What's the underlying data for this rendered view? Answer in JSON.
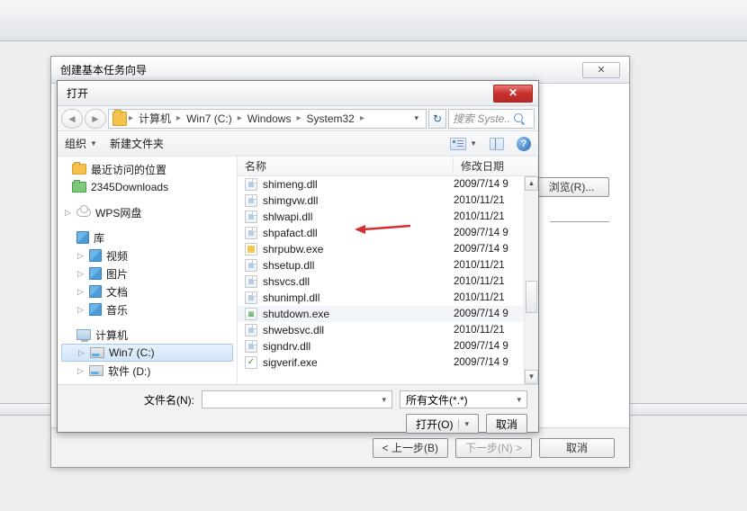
{
  "wizard": {
    "title": "创建基本任务向导",
    "browse": "浏览(R)...",
    "back": "< 上一步(B)",
    "next": "下一步(N) >",
    "cancel": "取消"
  },
  "dlg": {
    "title": "打开",
    "path": [
      "计算机",
      "Win7 (C:)",
      "Windows",
      "System32"
    ],
    "search_ph": "搜索 Syste..",
    "toolbar": {
      "org": "组织",
      "newf": "新建文件夹"
    },
    "cols": {
      "name": "名称",
      "date": "修改日期"
    },
    "fn_label": "文件名(N):",
    "filter": "所有文件(*.*)",
    "open": "打开(O)",
    "cancel": "取消"
  },
  "tree": {
    "fav": [
      {
        "l": "最近访问的位置"
      },
      {
        "l": "2345Downloads"
      }
    ],
    "wps": "WPS网盘",
    "lib": "库",
    "libs": [
      "视频",
      "图片",
      "文档",
      "音乐"
    ],
    "pc": "计算机",
    "drives": [
      "Win7 (C:)",
      "软件 (D:)"
    ]
  },
  "files": [
    {
      "n": "shimeng.dll",
      "d": "2009/7/14 9",
      "t": "dll"
    },
    {
      "n": "shimgvw.dll",
      "d": "2010/11/21",
      "t": "dll"
    },
    {
      "n": "shlwapi.dll",
      "d": "2010/11/21",
      "t": "dll"
    },
    {
      "n": "shpafact.dll",
      "d": "2009/7/14 9",
      "t": "dll"
    },
    {
      "n": "shrpubw.exe",
      "d": "2009/7/14 9",
      "t": "exe2"
    },
    {
      "n": "shsetup.dll",
      "d": "2010/11/21",
      "t": "dll"
    },
    {
      "n": "shsvcs.dll",
      "d": "2010/11/21",
      "t": "dll"
    },
    {
      "n": "shunimpl.dll",
      "d": "2010/11/21",
      "t": "dll"
    },
    {
      "n": "shutdown.exe",
      "d": "2009/7/14 9",
      "t": "exe",
      "sel": true
    },
    {
      "n": "shwebsvc.dll",
      "d": "2010/11/21",
      "t": "dll"
    },
    {
      "n": "signdrv.dll",
      "d": "2009/7/14 9",
      "t": "dll"
    },
    {
      "n": "sigverif.exe",
      "d": "2009/7/14 9",
      "t": "exe3"
    }
  ]
}
